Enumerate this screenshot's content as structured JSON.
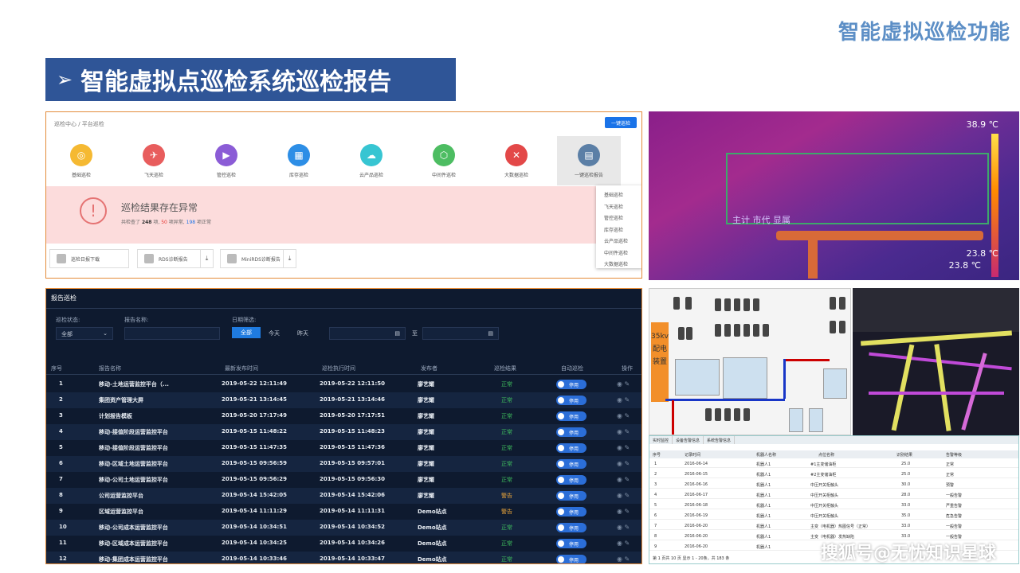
{
  "page": {
    "top_title": "智能虚拟巡检功能",
    "section_title": "智能虚拟点巡检系统巡检报告",
    "watermark": "搜狐号@无忧知识星球"
  },
  "panel1": {
    "breadcrumb": "巡检中心 / 平台巡检",
    "onekey_button": "一键巡检",
    "categories": [
      {
        "label": "基础巡检",
        "color": "#f5b932"
      },
      {
        "label": "飞天巡检",
        "color": "#e85d5d"
      },
      {
        "label": "管控巡检",
        "color": "#8b5cd6"
      },
      {
        "label": "库存巡检",
        "color": "#2d8ee6"
      },
      {
        "label": "云产品巡检",
        "color": "#37c5d2"
      },
      {
        "label": "中间件巡检",
        "color": "#4dbd62"
      },
      {
        "label": "大数据巡检",
        "color": "#e34848"
      },
      {
        "label": "一键巡检报告",
        "color": "#5b7fa6"
      }
    ],
    "alert_title": "巡检结果存在异常",
    "alert_prefix": "共检查了",
    "alert_total": "248",
    "alert_mid": "项,",
    "alert_abn": "50",
    "alert_mid2": "项异常,",
    "alert_ok": "198",
    "alert_suffix": "项正常",
    "downloads": [
      "巡检日报下载",
      "RDS诊断报告",
      "MiniRDS诊断报告"
    ],
    "dropdown": [
      "基础巡检",
      "飞天巡检",
      "管控巡检",
      "库存巡检",
      "云产品巡检",
      "中间件巡检",
      "大数据巡检"
    ]
  },
  "panel2": {
    "temp_max": "38.9 ℃",
    "temp_low1": "23.8 ℃",
    "temp_low2": "23.8 ℃",
    "caption": "主计 市代 显属"
  },
  "panel3": {
    "title": "报告巡检",
    "filter_status_label": "巡检状态:",
    "filter_status_value": "全部",
    "filter_name_label": "报告名称:",
    "filter_date_label": "日期筛选:",
    "btn_all": "全部",
    "btn_today": "今天",
    "btn_yesterday": "昨天",
    "to_label": "至",
    "columns": [
      "序号",
      "报告名称",
      "最新发布时间",
      "巡检执行时间",
      "发布者",
      "巡检结果",
      "自动巡检",
      "操作"
    ],
    "toggle_label": "停用",
    "rows": [
      {
        "no": "1",
        "name": "移动-土地运营监控平台（...",
        "pub": "2019-05-22 12:11:49",
        "exec": "2019-05-22 12:11:50",
        "by": "廖艺耀",
        "res": "正常"
      },
      {
        "no": "2",
        "name": "集团资产管理大屏",
        "pub": "2019-05-21 13:14:45",
        "exec": "2019-05-21 13:14:46",
        "by": "廖艺耀",
        "res": "正常"
      },
      {
        "no": "3",
        "name": "计划报告模板",
        "pub": "2019-05-20 17:17:49",
        "exec": "2019-05-20 17:17:51",
        "by": "廖艺耀",
        "res": "正常"
      },
      {
        "no": "4",
        "name": "移动-接值阶段运营监控平台",
        "pub": "2019-05-15 11:48:22",
        "exec": "2019-05-15 11:48:23",
        "by": "廖艺耀",
        "res": "正常"
      },
      {
        "no": "5",
        "name": "移动-接值阶段运营监控平台",
        "pub": "2019-05-15 11:47:35",
        "exec": "2019-05-15 11:47:36",
        "by": "廖艺耀",
        "res": "正常"
      },
      {
        "no": "6",
        "name": "移动-区域土地运营监控平台",
        "pub": "2019-05-15 09:56:59",
        "exec": "2019-05-15 09:57:01",
        "by": "廖艺耀",
        "res": "正常"
      },
      {
        "no": "7",
        "name": "移动-公司土地运营监控平台",
        "pub": "2019-05-15 09:56:29",
        "exec": "2019-05-15 09:56:30",
        "by": "廖艺耀",
        "res": "正常"
      },
      {
        "no": "8",
        "name": "公司运营监控平台",
        "pub": "2019-05-14 15:42:05",
        "exec": "2019-05-14 15:42:06",
        "by": "廖艺耀",
        "res": "警告"
      },
      {
        "no": "9",
        "name": "区域运营监控平台",
        "pub": "2019-05-14 11:11:29",
        "exec": "2019-05-14 11:11:31",
        "by": "Demo站点",
        "res": "警告"
      },
      {
        "no": "10",
        "name": "移动-公司成本运营监控平台",
        "pub": "2019-05-14 10:34:51",
        "exec": "2019-05-14 10:34:52",
        "by": "Demo站点",
        "res": "正常"
      },
      {
        "no": "11",
        "name": "移动-区域成本运营监控平台",
        "pub": "2019-05-14 10:34:25",
        "exec": "2019-05-14 10:34:26",
        "by": "Demo站点",
        "res": "正常"
      },
      {
        "no": "12",
        "name": "移动-集团成本运营监控平台",
        "pub": "2019-05-14 10:33:46",
        "exec": "2019-05-14 10:33:47",
        "by": "Demo站点",
        "res": "正常"
      }
    ]
  },
  "panel4": {
    "label_35kv": "35kv 配电 装置"
  },
  "panel6": {
    "tabs": [
      "实时监控",
      "设备告警信息",
      "系统告警信息"
    ],
    "columns": [
      "序号",
      "记录时间",
      "机器人名称",
      "点位名称",
      "识别结果",
      "告警等级"
    ],
    "rows": [
      [
        "1",
        "2016-06-14",
        "机器人1",
        "#1主变储油柜",
        "25.0",
        "正常"
      ],
      [
        "2",
        "2016-06-15",
        "机器人1",
        "#2主变储油柜",
        "25.0",
        "正常"
      ],
      [
        "3",
        "2016-06-16",
        "机器人1",
        "中压开关柜触头",
        "30.0",
        "预警"
      ],
      [
        "4",
        "2016-06-17",
        "机器人1",
        "中压开关柜触头",
        "28.0",
        "一般告警"
      ],
      [
        "5",
        "2016-06-18",
        "机器人1",
        "中压开关柜触头",
        "33.0",
        "严重告警"
      ],
      [
        "6",
        "2016-06-19",
        "机器人1",
        "中压开关柜触头",
        "35.0",
        "危急告警"
      ],
      [
        "7",
        "2016-06-20",
        "机器人1",
        "主变（电机器）热图信号（正常）",
        "33.0",
        "一般告警"
      ],
      [
        "8",
        "2016-06-20",
        "机器人1",
        "主变（电机器）发热缺陷",
        "33.0",
        "一般告警"
      ],
      [
        "9",
        "2016-06-20",
        "机器人1",
        "",
        "",
        ""
      ]
    ],
    "footer": "第 1 页共 10 页  显示 1 - 20条，共 183 条"
  }
}
